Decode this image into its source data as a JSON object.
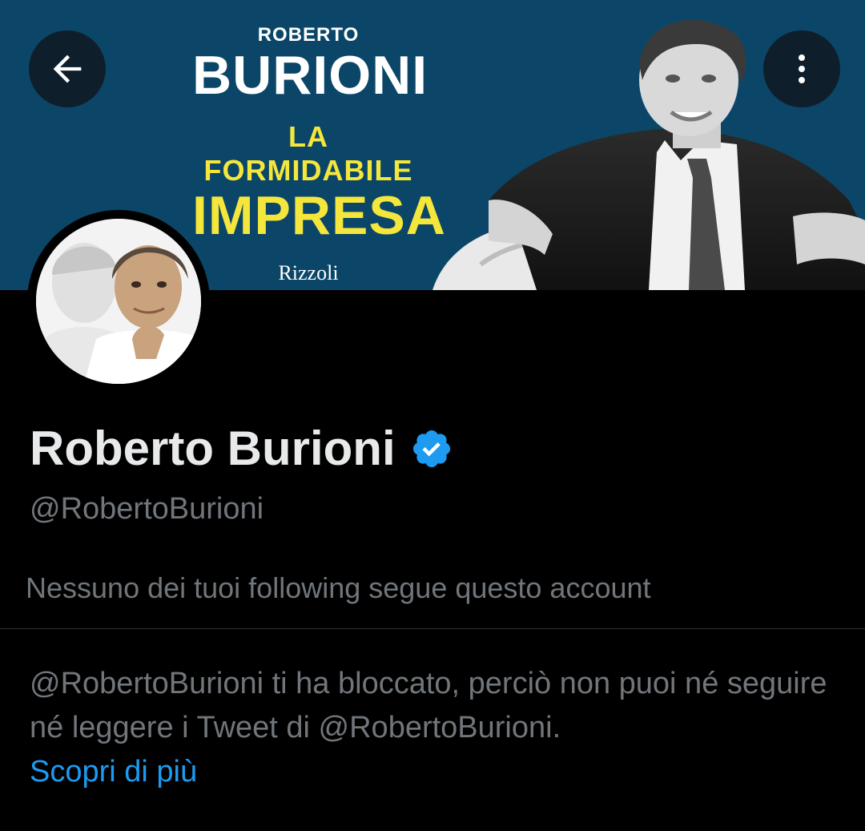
{
  "banner": {
    "author_first": "ROBERTO",
    "author_last": "BURIONI",
    "title_line1": "LA FORMIDABILE",
    "title_line2": "IMPRESA",
    "publisher": "Rizzoli"
  },
  "icons": {
    "back": "arrow-left-icon",
    "more": "more-vertical-icon",
    "verified": "verified-badge-icon"
  },
  "colors": {
    "banner_bg": "#0b4668",
    "accent_yellow": "#f5e63c",
    "link_blue": "#1d9bf0",
    "secondary_text": "#71767b"
  },
  "profile": {
    "name": "Roberto Burioni",
    "handle": "@RobertoBurioni",
    "followers_note": "Nessuno dei tuoi following segue questo account"
  },
  "blocked": {
    "message": "@RobertoBurioni ti ha bloccato, perciò non puoi né seguire né leggere i Tweet di @RobertoBurioni.",
    "learn_more": "Scopri di più"
  }
}
